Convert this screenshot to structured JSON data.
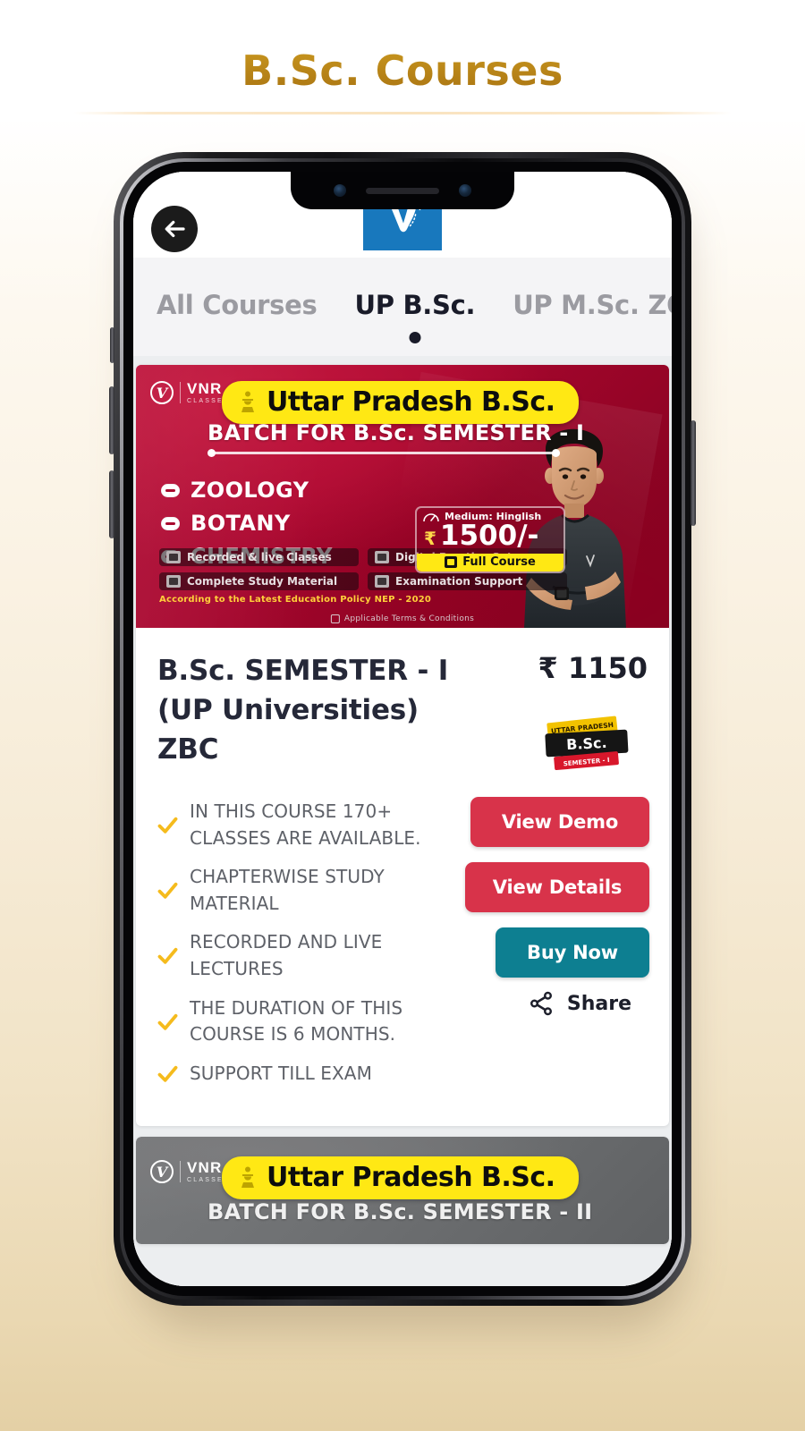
{
  "page": {
    "title": "B.Sc. Courses",
    "accent_color": "#b8860b",
    "background": "cream-gradient"
  },
  "app": {
    "topbar": {
      "back_icon": "arrow-left-icon",
      "logo": "vnr-v-logo",
      "logo_color": "#1878bd"
    },
    "tabs": [
      {
        "label": "All Courses",
        "active": false
      },
      {
        "label": "UP B.Sc.",
        "active": true
      },
      {
        "label": "UP M.Sc. ZOO",
        "active": false
      }
    ],
    "course": {
      "banner": {
        "brand_mark": "V",
        "brand_name": "VNR",
        "brand_sub": "CLASSES",
        "pill_text": "Uttar Pradesh B.Sc.",
        "pill_icon": "ashoka-emblem-icon",
        "pill_bg": "#ffe814",
        "batch_line": "BATCH FOR B.Sc. SEMESTER - I",
        "subjects": [
          "ZOOLOGY",
          "BOTANY",
          "CHEMISTRY"
        ],
        "medium_label": "Medium: Hinglish",
        "price_currency": "₹",
        "price_value": "1500/-",
        "full_course_label": "Full Course",
        "tags": [
          "Recorded & live Classes",
          "Digital Practice Sets",
          "Complete Study Material",
          "Examination Support"
        ],
        "nep_line": "According to the Latest Education Policy NEP - 2020",
        "terms_line": "Applicable Terms & Conditions",
        "bg_color": "#a8072f"
      },
      "title": "B.Sc. SEMESTER - I (UP Universities) ZBC",
      "price": "₹ 1150",
      "thumb": {
        "top_ribbon": "UTTAR PRADESH",
        "main_text": "B.Sc.",
        "bottom_ribbon": "SEMESTER - I"
      },
      "features": [
        "IN THIS COURSE 170+ CLASSES ARE AVAILABLE.",
        "CHAPTERWISE STUDY MATERIAL",
        "RECORDED AND LIVE LECTURES",
        "THE DURATION OF THIS COURSE IS 6 MONTHS.",
        "SUPPORT TILL EXAM"
      ],
      "actions": {
        "view_demo": "View Demo",
        "view_details": "View Details",
        "buy_now": "Buy Now",
        "share": "Share",
        "demo_color": "#d8334a",
        "details_color": "#d8334a",
        "buy_color": "#0d7f91"
      }
    },
    "next_course": {
      "brand_name": "VNR",
      "brand_sub": "CLASSES",
      "pill_text": "Uttar Pradesh B.Sc.",
      "batch_line": "BATCH FOR B.Sc. SEMESTER - II"
    }
  }
}
